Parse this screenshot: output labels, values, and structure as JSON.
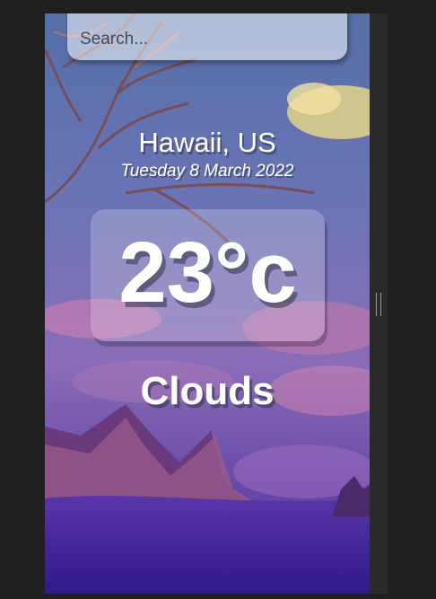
{
  "search": {
    "placeholder": "Search..."
  },
  "weather": {
    "location": "Hawaii, US",
    "date": "Tuesday 8 March 2022",
    "temperature": "23°c",
    "condition": "Clouds"
  },
  "colors": {
    "sky_top": "#5b6fae",
    "sky_mid": "#6c63b5",
    "mountain": "#5b2f6e",
    "ground": "#3a2580",
    "text": "#ffffff"
  }
}
